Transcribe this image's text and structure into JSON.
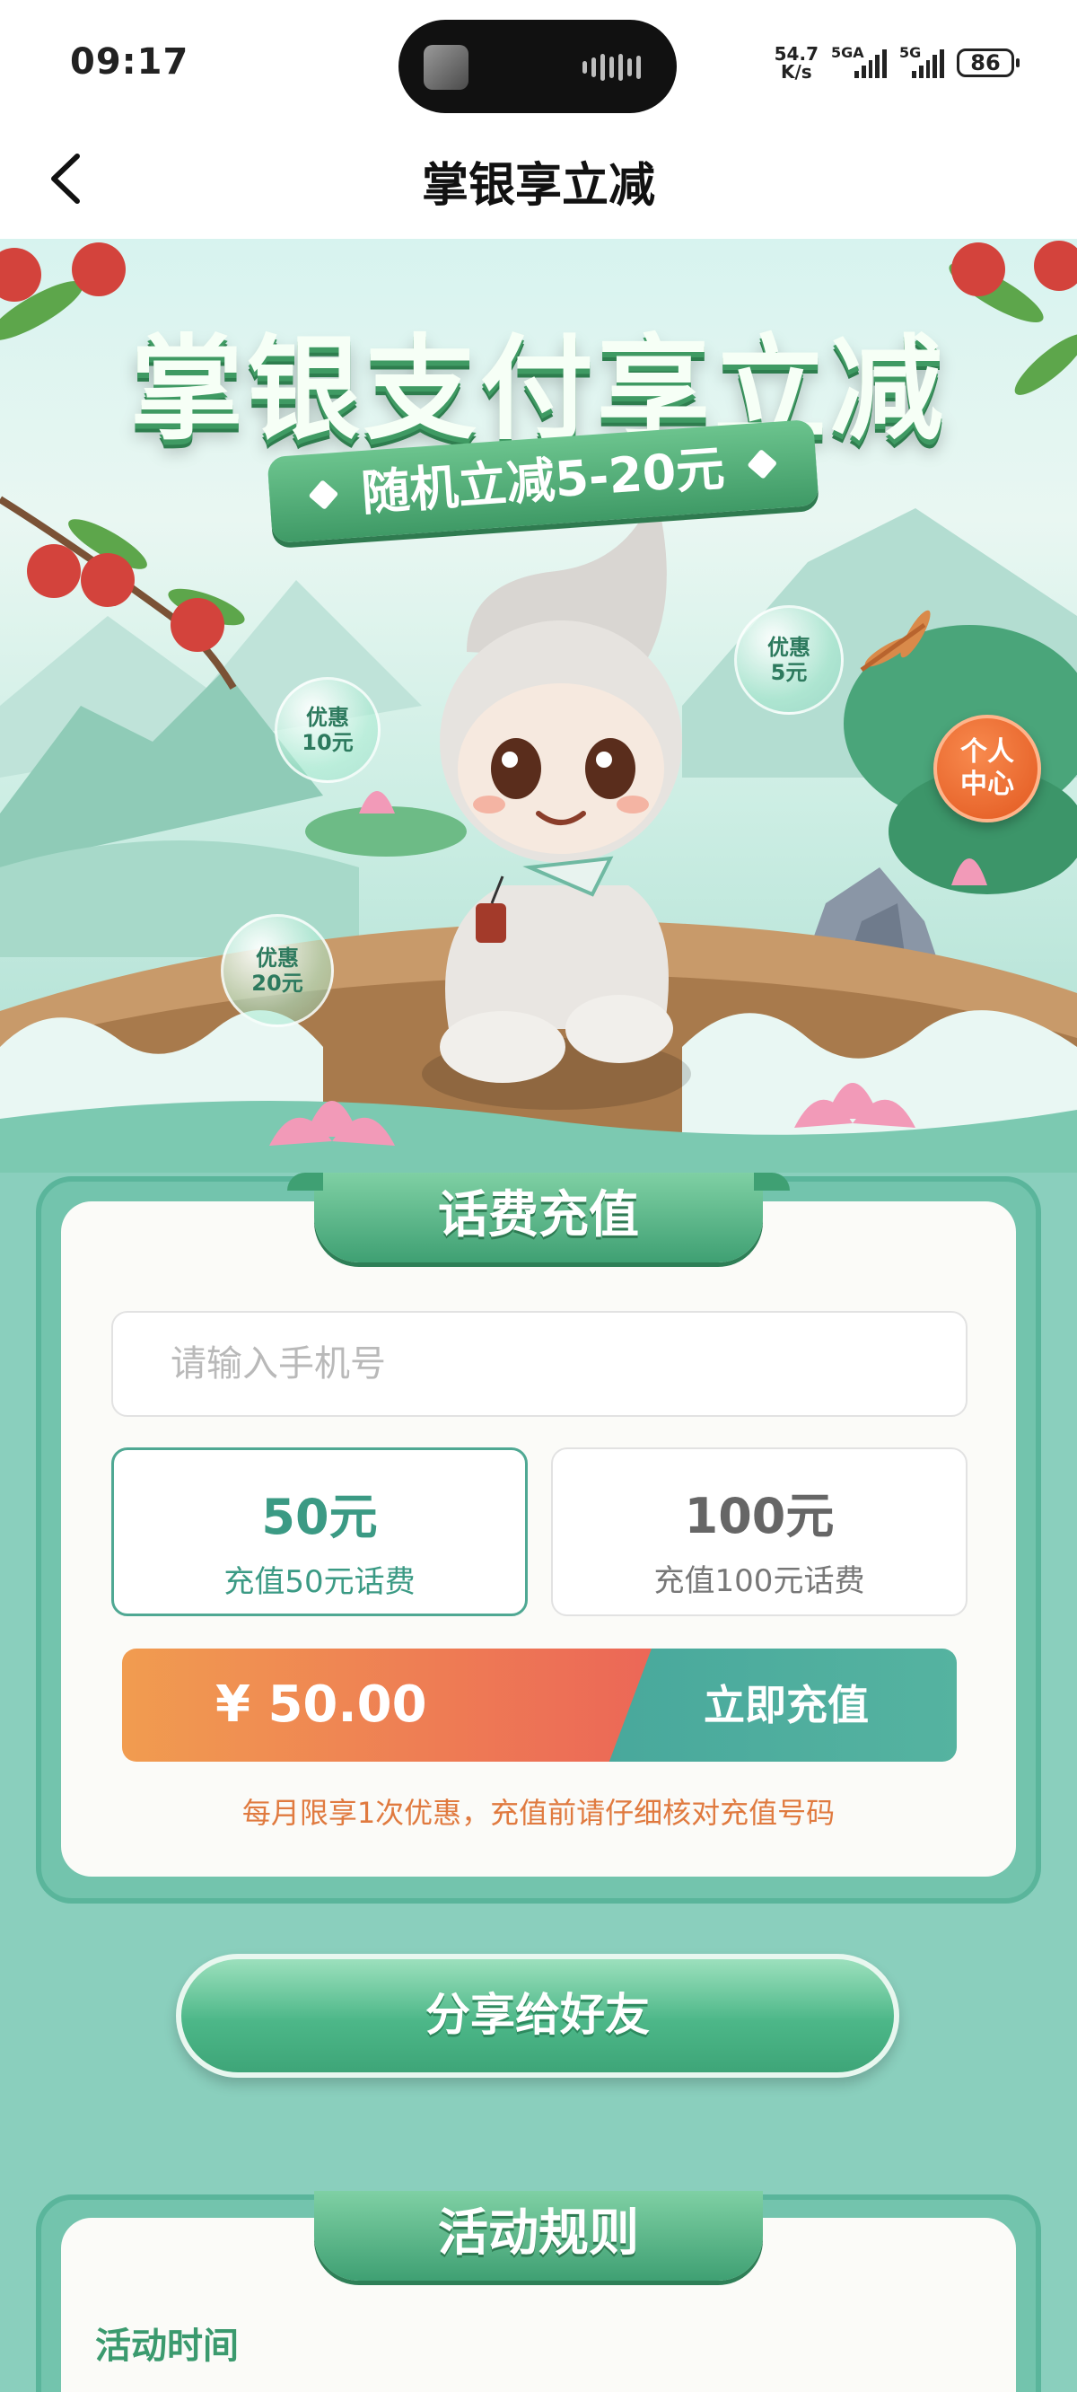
{
  "status_bar": {
    "time": "09:17",
    "net_speed_value": "54.7",
    "net_speed_unit": "K/s",
    "sim1_label": "5GA",
    "sim2_label": "5G",
    "battery": "86"
  },
  "nav": {
    "title": "掌银享立减"
  },
  "hero": {
    "title": "掌银支付享立减",
    "subtitle": "随机立减5-20元",
    "bubbles": [
      {
        "line1": "优惠",
        "line2": "10元"
      },
      {
        "line1": "优惠",
        "line2": "5元"
      },
      {
        "line1": "优惠",
        "line2": "20元"
      }
    ],
    "personal_center": {
      "line1": "个人",
      "line2": "中心"
    }
  },
  "recharge": {
    "section_title": "话费充值",
    "phone_placeholder": "请输入手机号",
    "phone_value": "",
    "options": [
      {
        "amount": "50元",
        "desc": "充值50元话费",
        "selected": true
      },
      {
        "amount": "100元",
        "desc": "充值100元话费",
        "selected": false
      }
    ],
    "price": "¥ 50.00",
    "submit_label": "立即充值",
    "notice": "每月限享1次优惠，充值前请仔细核对充值号码"
  },
  "share_label": "分享给好友",
  "rules": {
    "section_title": "活动规则",
    "first_item_label": "活动时间"
  },
  "colors": {
    "page_bg": "#8acfbd",
    "accent_green": "#3b9a84",
    "price_orange": "#f19c50",
    "notice_orange": "#e07a3f"
  }
}
